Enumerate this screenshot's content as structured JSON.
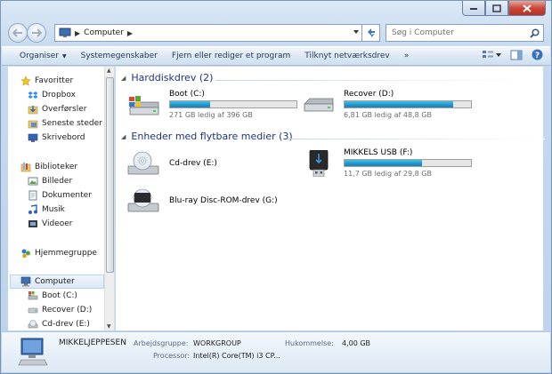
{
  "window": {
    "caption_buttons": [
      "minimize",
      "maximize",
      "close"
    ]
  },
  "address": {
    "crumb": "Computer",
    "search_placeholder": "Søg i Computer"
  },
  "toolbar": {
    "organize": "Organiser",
    "system_properties": "Systemegenskaber",
    "uninstall": "Fjern eller rediger et program",
    "map_drive": "Tilknyt netværksdrev"
  },
  "nav": {
    "favorites": "Favoritter",
    "dropbox": "Dropbox",
    "downloads": "Overførsler",
    "recent": "Seneste steder",
    "desktop": "Skrivebord",
    "libraries": "Biblioteker",
    "pictures": "Billeder",
    "documents": "Dokumenter",
    "music": "Musik",
    "videos": "Videoer",
    "homegroup": "Hjemmegruppe",
    "computer": "Computer",
    "boot": "Boot (C:)",
    "recover": "Recover (D:)",
    "cd": "Cd-drev (E:)"
  },
  "groups": {
    "hdd": "Harddiskdrev (2)",
    "removable": "Enheder med flytbare medier (3)"
  },
  "drives": {
    "c": {
      "name": "Boot (C:)",
      "free": "271 GB ledig af 396 GB",
      "used_fraction": 0.32
    },
    "d": {
      "name": "Recover (D:)",
      "free": "6,81 GB ledig af 48,8 GB",
      "used_fraction": 0.86
    },
    "e": {
      "name": "Cd-drev (E:)"
    },
    "f": {
      "name": "MIKKELS USB (F:)",
      "free": "11,7 GB ledig af 29,8 GB",
      "used_fraction": 0.61
    },
    "g": {
      "name": "Blu-ray Disc-ROM-drev (G:)"
    }
  },
  "details": {
    "name": "MIKKELJEPPESEN",
    "workgroup_label": "Arbejdsgruppe:",
    "workgroup": "WORKGROUP",
    "memory_label": "Hukommelse:",
    "memory": "4,00 GB",
    "processor_label": "Processor:",
    "processor": "Intel(R) Core(TM) i3 CP..."
  },
  "colors": {
    "accent": "#1e3287",
    "bar": "#2590c8"
  }
}
